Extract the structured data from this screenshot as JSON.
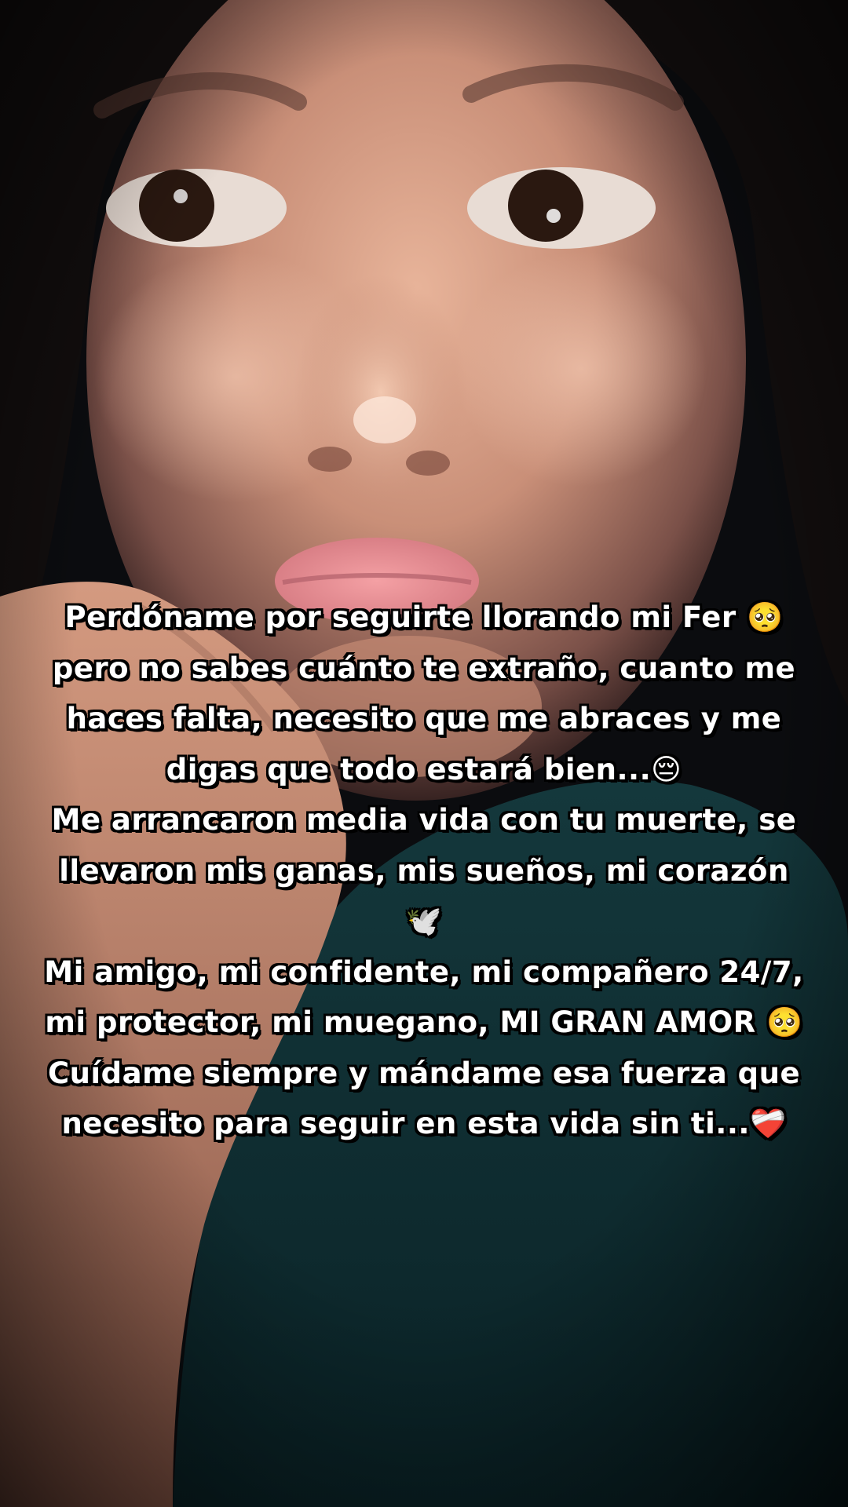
{
  "caption": {
    "lines": [
      "Perdóname por seguirte llorando mi Fer 🥺",
      "pero no sabes cuánto te extraño, cuanto me",
      "haces falta, necesito que me abraces y me",
      "digas que todo estará bien...😔",
      "Me arrancaron media vida con tu muerte, se",
      "llevaron mis ganas, mis sueños, mi corazón",
      "🕊️",
      "Mi amigo, mi confidente, mi compañero 24/7,",
      "mi protector, mi muegano, MI GRAN AMOR 🥺",
      "Cuídame siempre y mándame esa fuerza que",
      "necesito para seguir en esta vida sin ti...❤️‍🩹"
    ]
  }
}
